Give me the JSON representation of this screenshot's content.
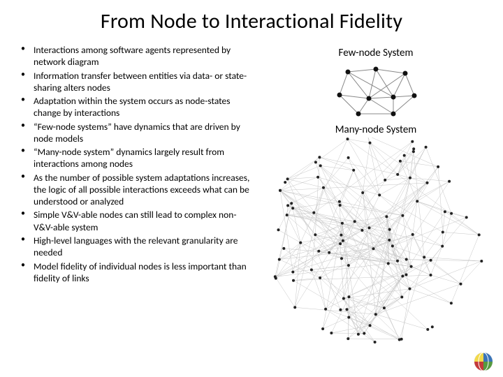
{
  "title": "From Node to Interactional Fidelity",
  "bullets": [
    "Interactions among software agents represented by network diagram",
    "Information transfer between entities via data- or state-sharing alters nodes",
    "Adaptation within the system occurs as node-states change by interactions",
    "“Few-node systems” have dynamics that are driven by node models",
    "“Many-node system” dynamics largely result from interactions among nodes",
    "As the number of possible system adaptations increases, the logic of all possible interactions exceeds what can be understood or analyzed",
    "Simple V&V-able nodes can still lead to complex non-V&V-able system",
    "High-level languages with the relevant granularity are needed",
    "Model fidelity of individual nodes is less important than fidelity of links"
  ],
  "labels": {
    "few": "Few-node System",
    "many": "Many-node System"
  }
}
